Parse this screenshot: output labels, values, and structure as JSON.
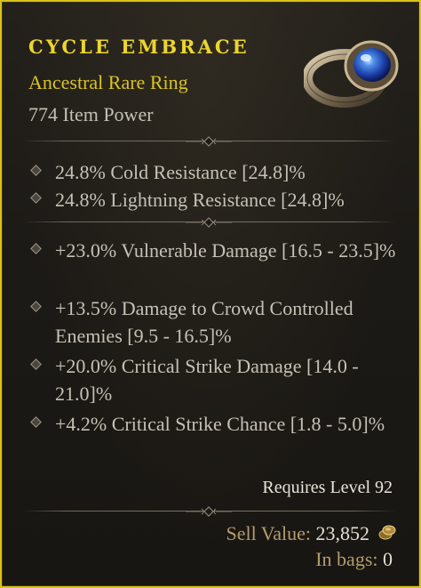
{
  "item": {
    "name": "CYCLE EMBRACE",
    "type": "Ancestral Rare Ring",
    "item_power": "774 Item Power",
    "icon": "ring-icon"
  },
  "implicits": [
    {
      "text": "24.8% Cold Resistance [24.8]%"
    },
    {
      "text": "24.8% Lightning Resistance [24.8]%"
    }
  ],
  "affixes": [
    {
      "text": "+23.0% Vulnerable Damage [16.5 - 23.5]%"
    },
    {
      "text": "+13.5% Damage to Crowd Controlled Enemies [9.5 - 16.5]%"
    },
    {
      "text": "+20.0% Critical Strike Damage [14.0 - 21.0]%"
    },
    {
      "text": "+4.2% Critical Strike Chance [1.8 - 5.0]%"
    }
  ],
  "requirement": "Requires Level 92",
  "sell": {
    "label": "Sell Value:",
    "value": "23,852",
    "icon": "gold-coin-icon"
  },
  "bags": {
    "label": "In bags:",
    "value": "0"
  },
  "colors": {
    "border": "#d8c21c",
    "name": "#ecd52f",
    "rarity": "#d8c324",
    "body_text": "#c6c1b5",
    "label": "#b59b6c"
  }
}
